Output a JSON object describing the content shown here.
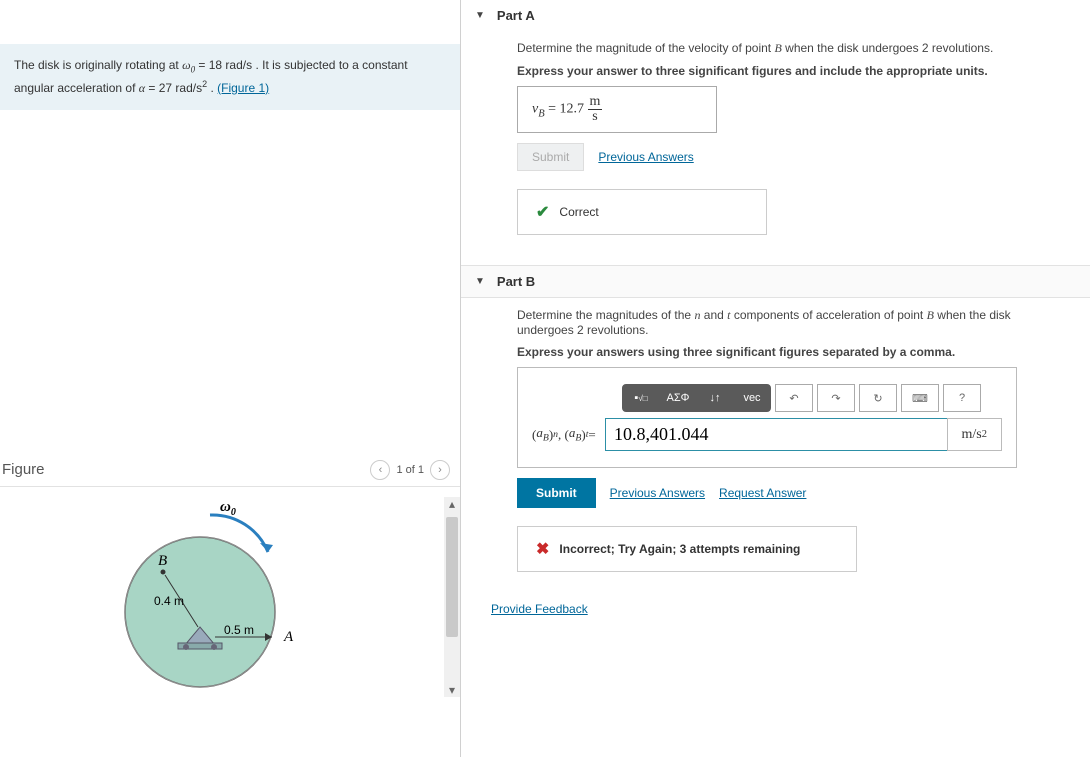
{
  "problem": {
    "text1": "The disk is originally rotating at ",
    "var1": "ω",
    "sub1": "0",
    "eq1": " = 18  rad/s",
    "text2": " . It is subjected to a constant angular acceleration of ",
    "var2": "α",
    "eq2": " = 27  rad/s",
    "sup2": "2",
    "text3": " . ",
    "figure_link": "(Figure 1)"
  },
  "figure": {
    "title": "Figure",
    "nav_text": "1 of 1",
    "omega_label": "ω",
    "omega_sub": "0",
    "label_B": "B",
    "label_A": "A",
    "dim1": "0.4 m",
    "dim2": "0.5 m"
  },
  "partA": {
    "title": "Part A",
    "question": "Determine the magnitude of the velocity of point ",
    "question_B": "B",
    "question_tail": " when the disk undergoes 2 revolutions.",
    "instruction": "Express your answer to three significant figures and include the appropriate units.",
    "ans_var": "v",
    "ans_sub": "B",
    "ans_eq": " =  12.7 ",
    "ans_unit_top": "m",
    "ans_unit_bot": "s",
    "submit_label": "Submit",
    "prev_label": "Previous Answers",
    "feedback": "Correct"
  },
  "partB": {
    "title": "Part B",
    "question1": "Determine the magnitudes of the ",
    "n": "n",
    "and": " and ",
    "t": "t",
    "question2": " components of acceleration of point ",
    "B": "B",
    "question3": " when the disk undergoes 2 revolutions.",
    "instruction": "Express your answers using three significant figures separated by a comma.",
    "prefix": "(aB)n, (aB)t = ",
    "input_value": "10.8,401.044",
    "unit": "m/s",
    "unit_sup": "2",
    "submit_label": "Submit",
    "prev_label": "Previous Answers",
    "req_label": "Request Answer",
    "feedback": "Incorrect; Try Again; 3 attempts remaining",
    "toolbar": {
      "greek": "ΑΣΦ",
      "vec": "vec",
      "help": "?"
    }
  },
  "provide_feedback": "Provide Feedback"
}
